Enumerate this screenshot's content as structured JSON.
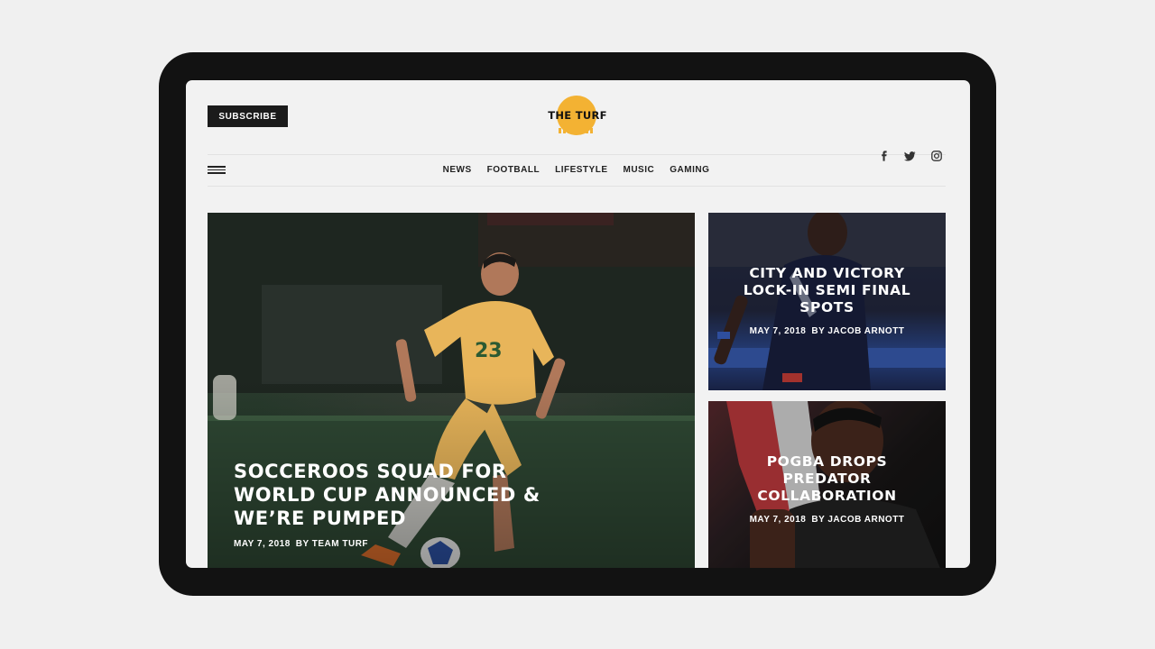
{
  "header": {
    "subscribe_label": "SUBSCRIBE",
    "logo_text": "THE TURF",
    "social": [
      {
        "icon": "facebook-icon",
        "glyph": "f"
      },
      {
        "icon": "twitter-icon",
        "glyph": "🐦"
      },
      {
        "icon": "instagram-icon",
        "glyph": "◻"
      }
    ]
  },
  "nav": {
    "items": [
      "NEWS",
      "FOOTBALL",
      "LIFESTYLE",
      "MUSIC",
      "GAMING"
    ]
  },
  "articles": {
    "main": {
      "title_l1": "SOCCEROOS SQUAD FOR",
      "title_l2": "WORLD CUP ANNOUNCED &",
      "title_l3": "WE’RE PUMPED",
      "date": "MAY 7, 2018",
      "byline": "BY TEAM TURF"
    },
    "side1": {
      "title_l1": "CITY AND VICTORY",
      "title_l2": "LOCK-IN SEMI FINAL",
      "title_l3": "SPOTS",
      "date": "MAY 7, 2018",
      "byline": "BY JACOB ARNOTT"
    },
    "side2": {
      "title_l1": "POGBA DROPS",
      "title_l2": "PREDATOR",
      "title_l3": "COLLABORATION",
      "date": "MAY 7, 2018",
      "byline": "BY JACOB ARNOTT"
    }
  },
  "colors": {
    "accent": "#f3b233",
    "button_bg": "#1b1b1b",
    "page_bg": "#f2f2f2",
    "device_frame": "#121212"
  }
}
